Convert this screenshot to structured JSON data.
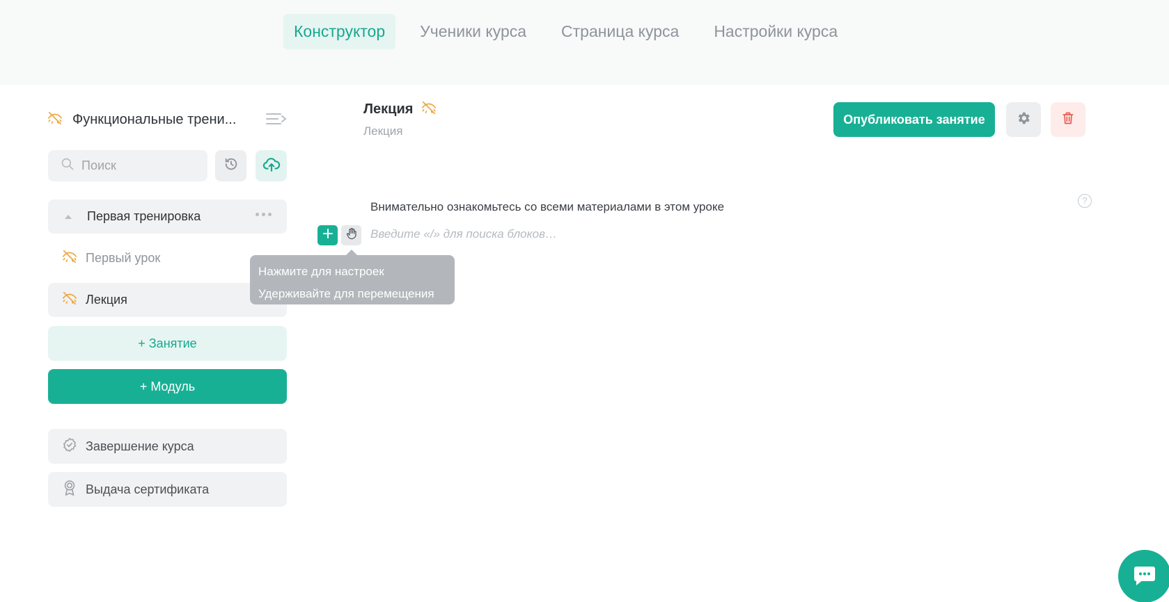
{
  "tabs": [
    {
      "label": "Конструктор",
      "active": true
    },
    {
      "label": "Ученики курса",
      "active": false
    },
    {
      "label": "Страница курса",
      "active": false
    },
    {
      "label": "Настройки курса",
      "active": false
    }
  ],
  "sidebar": {
    "course_title": "Функциональные трени...",
    "search_placeholder": "Поиск",
    "module": {
      "label": "Первая тренировка"
    },
    "lessons": [
      {
        "label": "Первый урок",
        "hidden": true
      },
      {
        "label": "Лекция",
        "hidden": true,
        "selected": true
      }
    ],
    "add_lesson_label": "+ Занятие",
    "add_module_label": "+ Модуль",
    "finish_label": "Завершение курса",
    "certificate_label": "Выдача сертификата"
  },
  "main": {
    "title": "Лекция",
    "subtitle": "Лекция",
    "publish_label": "Опубликовать занятие",
    "description": "Внимательно ознакомьтесь со всеми материалами в этом уроке",
    "block_placeholder": "Введите «/» для поиска блоков…",
    "help_symbol": "?"
  },
  "tooltip": {
    "line1": "Нажмите для настроек",
    "line2": "Удерживайте для перемещения"
  },
  "colors": {
    "accent": "#18b095",
    "accent_light": "#e6f5f2",
    "warning_icon": "#f0a63c",
    "danger": "#e85a4f"
  },
  "icons": {
    "hidden": "eye-off-icon",
    "collapse": "collapse-menu-icon",
    "search": "search-icon",
    "history": "history-icon",
    "upload": "cloud-upload-icon",
    "settings": "gear-icon",
    "delete": "trash-icon",
    "add": "plus-icon",
    "drag": "hand-drag-icon",
    "finish": "badge-check-icon",
    "certificate": "award-icon",
    "chat": "chat-icon"
  }
}
